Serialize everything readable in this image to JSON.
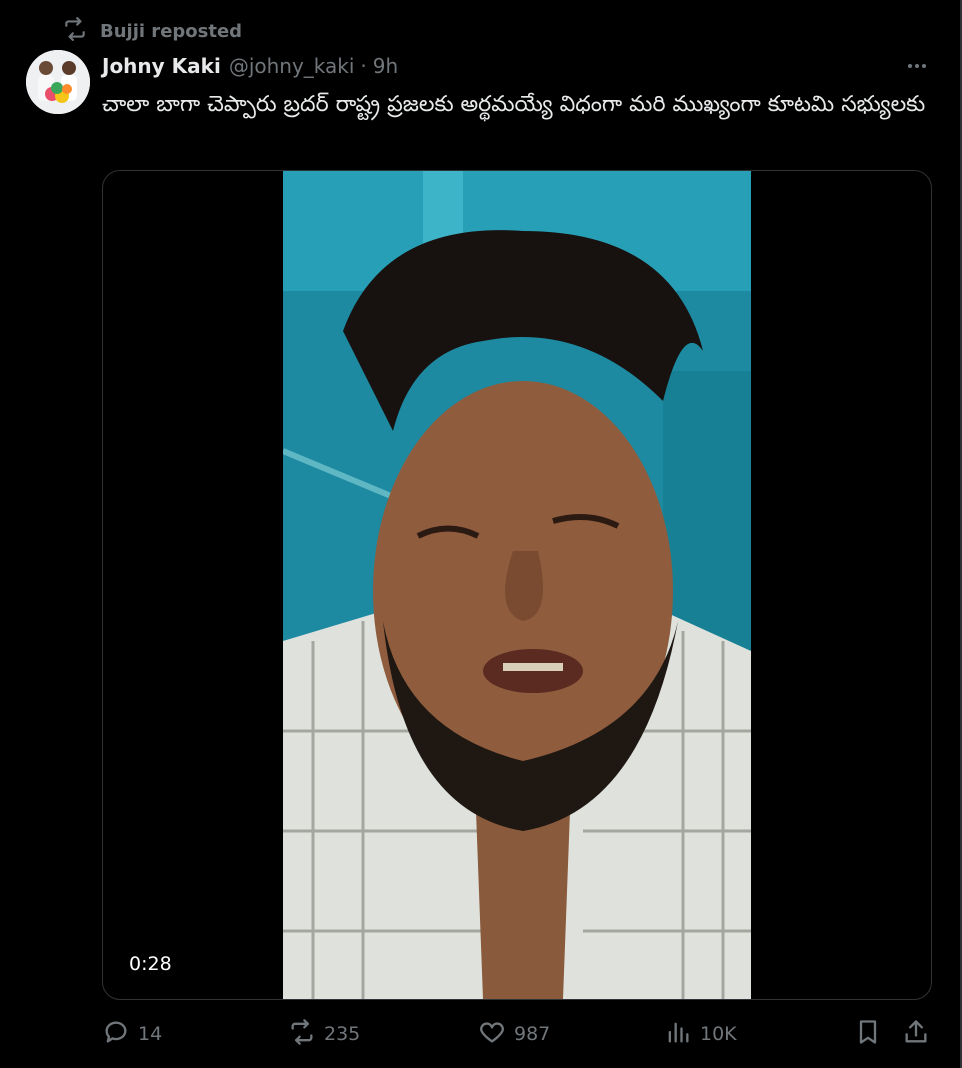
{
  "repost": {
    "label": "Bujji reposted",
    "icon": "repost-icon"
  },
  "author": {
    "name": "Johny Kaki",
    "handle": "@johny_kaki",
    "separator": "·",
    "time": "9h"
  },
  "tweet": {
    "text": "చాలా బాగా చెప్పారు బ్రదర్ రాష్ట్ర ప్రజలకు అర్థమయ్యే విధంగా మరి ముఖ్యంగా కూటమి సభ్యులకు"
  },
  "media": {
    "duration": "0:28"
  },
  "actions": {
    "replies": "14",
    "reposts": "235",
    "likes": "987",
    "views": "10K"
  },
  "colors": {
    "background": "#000000",
    "text": "#e7e9ea",
    "muted": "#71767b",
    "border": "#2f3336",
    "video_wall": "#1f8fa5"
  }
}
